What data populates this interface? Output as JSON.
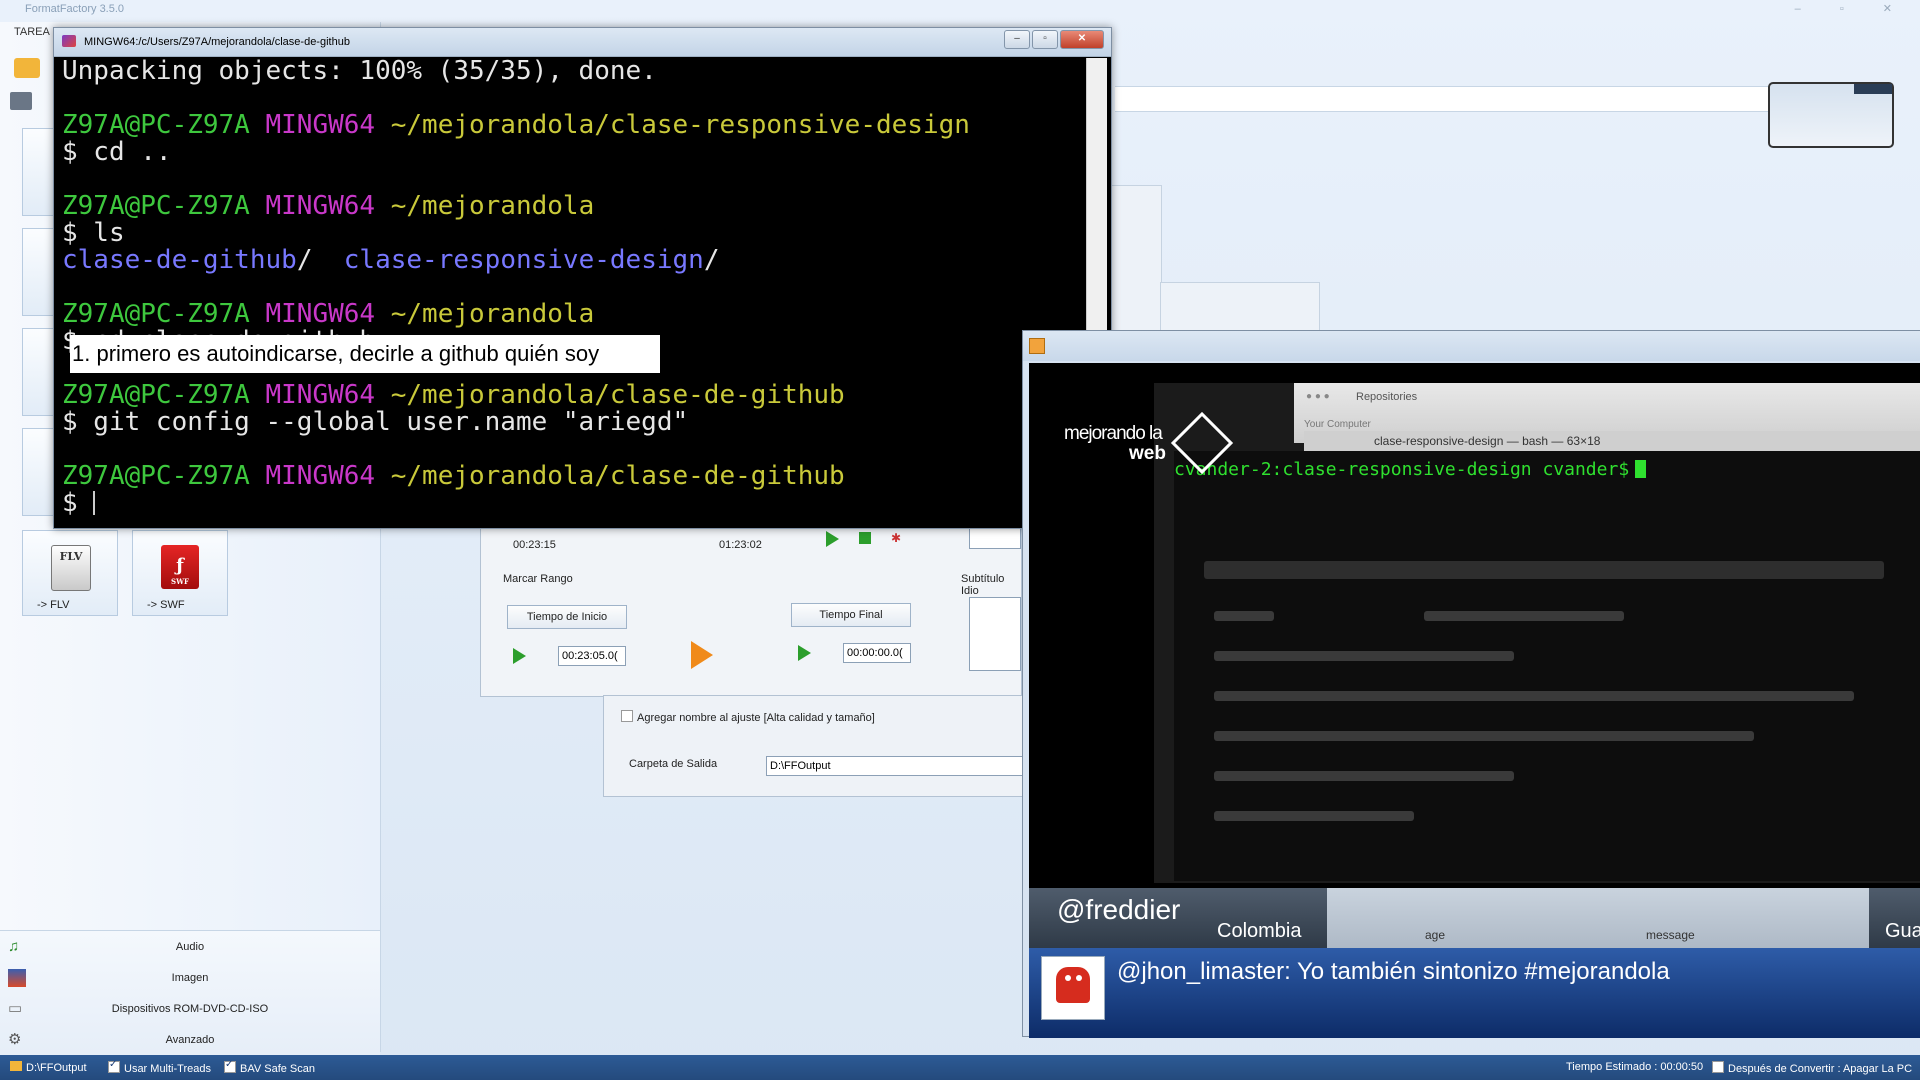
{
  "formatfactory": {
    "title": "FormatFactory 3.5.0",
    "tab": "TAREA",
    "cards": [
      {
        "label": "-> FLV",
        "icon": "flv-icon",
        "icon_text": "FLV"
      },
      {
        "label": "-> SWF",
        "icon": "swf-icon",
        "icon_text": "SWF"
      }
    ],
    "categories": [
      {
        "label": "Audio",
        "icon": "music-note-icon"
      },
      {
        "label": "Imagen",
        "icon": "image-icon"
      },
      {
        "label": "Dispositivos ROM-DVD-CD-ISO",
        "icon": "disc-drive-icon"
      },
      {
        "label": "Avanzado",
        "icon": "gears-icon"
      }
    ],
    "clip": {
      "time_start_display": "00:23:15",
      "time_end_display": "01:23:02",
      "range_label": "Marcar Rango",
      "start_button": "Tiempo de Inicio",
      "end_button": "Tiempo Final",
      "start_value": "00:23:05.0(",
      "end_value": "00:00:00.0(",
      "subtitle_label": "Subtítulo Idio"
    },
    "options": {
      "add_name_label": "Agregar nombre al ajuste [Alta calidad y tamaño]",
      "output_label": "Carpeta de Salida",
      "output_value": "D:\\FFOutput"
    },
    "status": {
      "folder": "D:\\FFOutput",
      "multithreads": "Usar Multi-Treads",
      "bav": "BAV Safe Scan",
      "estimated": "Tiempo Estimado : 00:00:50",
      "after": "Después de Convertir : Apagar La PC"
    }
  },
  "terminal": {
    "title": "MINGW64:/c/Users/Z97A/mejorandola/clase-de-github",
    "caption": "1. primero es autoindicarse, decirle a github quién soy",
    "lines": {
      "l1": "Unpacking objects: 100% (35/35), done.",
      "l2_user": "Z97A@PC-Z97A",
      "l2_sys": "MINGW64",
      "l2_path": "~/mejorandola/clase-responsive-design",
      "l3": "$ cd ..",
      "l4_user": "Z97A@PC-Z97A",
      "l4_sys": "MINGW64",
      "l4_path": "~/mejorandola",
      "l5": "$ ls",
      "l6_a": "clase-de-github",
      "l6_a_slash": "/",
      "l6_b": "clase-responsive-design",
      "l6_b_slash": "/",
      "l7_user": "Z97A@PC-Z97A",
      "l7_sys": "MINGW64",
      "l7_path": "~/mejorandola",
      "l8": "$ cd clase-de-github",
      "l9_user": "Z97A@PC-Z97A",
      "l9_sys": "MINGW64",
      "l9_path": "~/mejorandola/clase-de-github",
      "l10": "$ git config --global user.name \"ariegd\"",
      "l11_user": "Z97A@PC-Z97A",
      "l11_sys": "MINGW64",
      "l11_path": "~/mejorandola/clase-de-github",
      "l12": "$ "
    }
  },
  "video": {
    "logo_line1": "mejorando la",
    "logo_line2": "web",
    "finder_title": "Repositories",
    "finder_sub": "Your Computer",
    "shell_title": "clase-responsive-design — bash — 63×18",
    "shell_prompt": "cvander-2:clase-responsive-design cvander$",
    "handle": "@freddier",
    "country": "Colombia",
    "right_country": "Guat",
    "col_age": "age",
    "col_message": "message",
    "message": "@jhon_limaster: Yo también sintonizo #mejorandola"
  },
  "colors": {
    "prompt_green": "#3ec83e",
    "prompt_magenta": "#c938c9",
    "path_yellow": "#c9c93a",
    "dir_blue": "#7878ff",
    "status_bar": "#2d5b96"
  }
}
